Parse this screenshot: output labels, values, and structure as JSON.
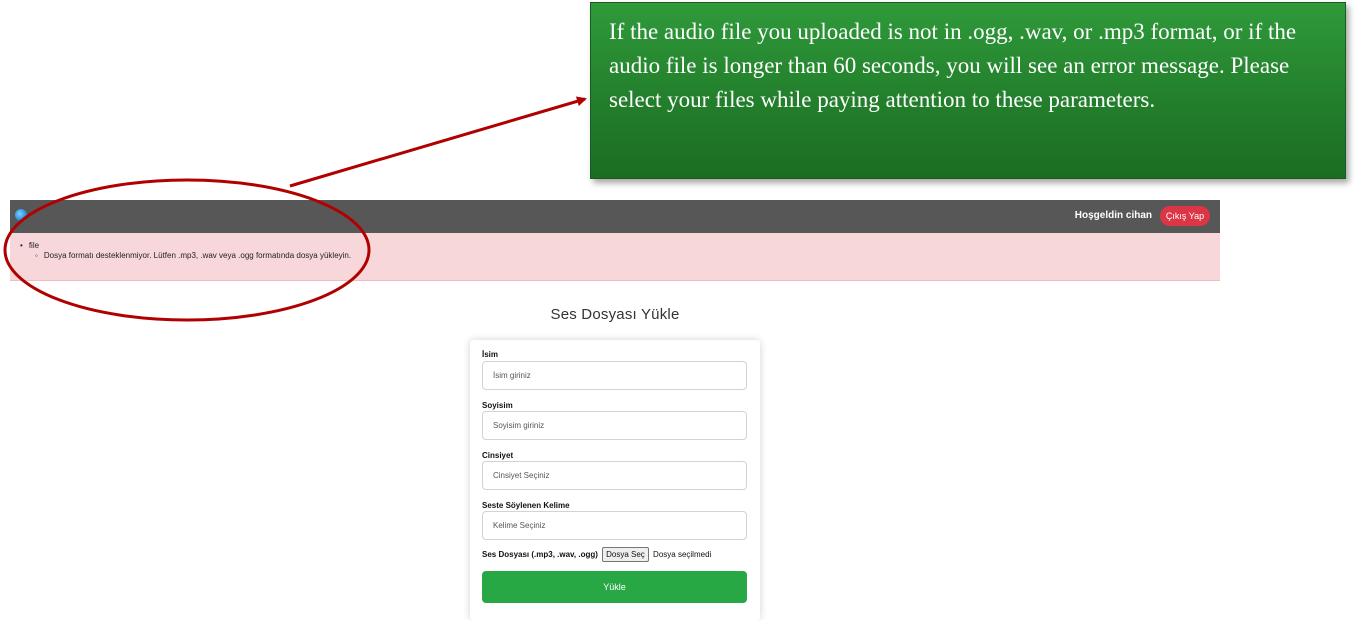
{
  "callout": {
    "text": "If the audio file you uploaded is not in .ogg, .wav, or .mp3 format, or if the audio file is longer than 60 seconds, you will see an error message. Please select your files while paying attention to these parameters."
  },
  "navbar": {
    "logo_icon": "app-logo-icon",
    "welcome": "Hoşgeldin cihan",
    "logout_label": "Çıkış Yap"
  },
  "alert": {
    "field": "file",
    "message": "Dosya formatı desteklenmiyor. Lütfen .mp3, .wav veya .ogg formatında dosya yükleyin."
  },
  "page": {
    "title": "Ses Dosyası Yükle"
  },
  "form": {
    "name_label": "İsim",
    "name_placeholder": "İsim giriniz",
    "surname_label": "Soyisim",
    "surname_placeholder": "Soyisim giriniz",
    "gender_label": "Cinsiyet",
    "gender_value": "Cinsiyet Seçiniz",
    "word_label": "Seste Söylenen Kelime",
    "word_value": "Kelime Seçiniz",
    "file_label": "Ses Dosyası (.mp3, .wav, .ogg)",
    "file_button": "Dosya Seç",
    "file_status": "Dosya seçilmedi",
    "submit_label": "Yükle"
  },
  "colors": {
    "callout_green": "#237f2c",
    "annotation_red": "#b00000",
    "navbar": "#575757",
    "alert_bg": "#f8d7da",
    "logout_red": "#dc3545",
    "submit_green": "#28a745"
  }
}
